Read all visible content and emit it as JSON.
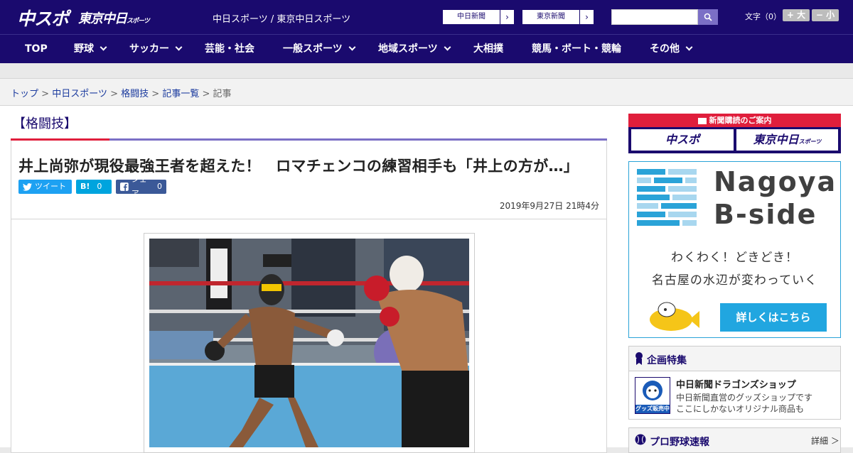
{
  "header": {
    "logo_chuspo": "中スポ",
    "logo_tokyo": "東京中日",
    "logo_tokyo_small": "スポーツ",
    "site_title": "中日スポーツ / 東京中日スポーツ",
    "paper_links": [
      {
        "label": "中日新聞"
      },
      {
        "label": "東京新聞"
      }
    ],
    "search_placeholder": "",
    "font_size_label": "文字（0）",
    "font_plus": "+ 大",
    "font_minus": "− 小"
  },
  "nav": {
    "items": [
      {
        "label": "TOP"
      },
      {
        "label": "野球"
      },
      {
        "label": "サッカー"
      },
      {
        "label": "芸能・社会"
      },
      {
        "label": "一般スポーツ"
      },
      {
        "label": "地域スポーツ"
      },
      {
        "label": "大相撲"
      },
      {
        "label": "競馬・ボート・競輪"
      },
      {
        "label": "その他"
      }
    ]
  },
  "breadcrumb": {
    "items": [
      "トップ",
      "中日スポーツ",
      "格闘技",
      "記事一覧"
    ],
    "current": "記事",
    "sep": ">"
  },
  "article": {
    "category": "【格闘技】",
    "headline": "井上尚弥が現役最強王者を超えた！　ロマチェンコの練習相手も「井上の方が…」",
    "share": {
      "tweet": "ツイート",
      "hatena_icon": "B!",
      "hatena_count": "0",
      "facebook": "シェア",
      "facebook_count": "0"
    },
    "date": "2019年9月27日 21時4分"
  },
  "sidebar": {
    "subscribe_head": "新聞購読のご案内",
    "subscribe_left": "中スポ",
    "subscribe_right": "東京中日",
    "subscribe_right_small": "スポーツ",
    "ad": {
      "title1": "Nagoya",
      "title2": "B-side",
      "line1": "わくわく！どきどき！",
      "line2": "名古屋の水辺が変わっていく",
      "cta": "詳しくはこちら"
    },
    "feature": {
      "head": "企画特集",
      "title": "中日新聞ドラゴンズショップ",
      "desc1": "中日新聞直営のグッズショップです",
      "desc2": "ここにしかないオリジナル商品も",
      "thumb_text": "グッズ販売中"
    },
    "baseball": {
      "head": "プロ野球速報",
      "detail": "詳細 ＞"
    }
  },
  "colors": {
    "brand_navy": "#1a0a6e",
    "accent_red": "#e01e3c",
    "accent_purple": "#7b6fc6",
    "twitter": "#1da1f2",
    "hatena": "#00a4de",
    "facebook": "#3b5998",
    "ad_blue": "#21a6e0"
  }
}
